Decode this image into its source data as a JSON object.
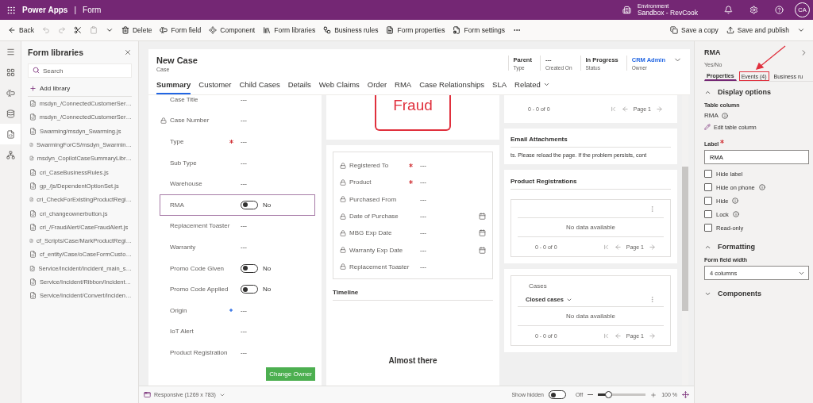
{
  "app_bar": {
    "app": "Power Apps",
    "separator": "|",
    "page": "Form",
    "environment_label": "Environment",
    "environment": "Sandbox - RevCook",
    "avatar": "CA"
  },
  "toolbar": {
    "items": [
      {
        "kind": "back",
        "label": "Back",
        "disabled": false
      },
      {
        "kind": "undo",
        "disabled": true
      },
      {
        "kind": "redo",
        "disabled": true
      },
      {
        "kind": "cut",
        "disabled": false
      },
      {
        "kind": "paste",
        "disabled": true
      },
      {
        "kind": "chevron"
      },
      {
        "kind": "delete",
        "label": "Delete",
        "disabled": false
      },
      {
        "kind": "field",
        "label": "Form field",
        "disabled": false
      },
      {
        "kind": "component",
        "label": "Component",
        "disabled": false
      },
      {
        "kind": "libraries",
        "label": "Form libraries",
        "disabled": false
      },
      {
        "kind": "rules",
        "label": "Business rules",
        "disabled": false
      },
      {
        "kind": "properties",
        "label": "Form properties",
        "disabled": false
      },
      {
        "kind": "settings",
        "label": "Form settings",
        "disabled": false
      },
      {
        "kind": "more",
        "disabled": false
      }
    ],
    "right": [
      {
        "kind": "copy",
        "label": "Save a copy"
      },
      {
        "kind": "publish",
        "label": "Save and publish"
      },
      {
        "kind": "chevron"
      }
    ]
  },
  "rail": [
    {
      "kind": "menu",
      "selected": false
    },
    {
      "kind": "components",
      "selected": false
    },
    {
      "kind": "fields",
      "selected": false
    },
    {
      "kind": "tables",
      "selected": false
    },
    {
      "kind": "libraries",
      "selected": true
    },
    {
      "kind": "tree",
      "selected": false
    }
  ],
  "libraries_panel": {
    "title": "Form libraries",
    "search": {
      "placeholder": "Search"
    },
    "add": "Add library",
    "items": [
      "msdyn_/ConnectedCustomerSer…",
      "msdyn_/ConnectedCustomerSer…",
      "Swarming/msdyn_Swarming.js",
      "SwarmingForCS/msdyn_Swarmin…",
      "msdyn_CopilotCaseSummaryLibr…",
      "cri_CaseBusinessRules.js",
      "gp_/js/DependentOptionSet.js",
      "cri_CheckForExistingProductRegi…",
      "cri_changeownerbutton.js",
      "cri_/FraudAlert/CaseFraudAlert.js",
      "cf_Scripts/Case/MarkProductRegi…",
      "cf_entity/Case/oCaseFormCusto…",
      "Service/Incident/Incident_main_s…",
      "Service/Incident/Ribbon/Incident…",
      "Service/Incident/Convert/Inciden…"
    ]
  },
  "form": {
    "title": "New Case",
    "entity": "Case",
    "header_fields": [
      {
        "value": "Parent",
        "label": "Type",
        "link": false
      },
      {
        "value": "---",
        "label": "Created On",
        "link": false
      },
      {
        "value": "In Progress",
        "label": "Status",
        "link": false
      },
      {
        "value": "CRM Admin",
        "label": "Owner",
        "link": true
      }
    ],
    "tabs": [
      {
        "label": "Summary",
        "selected": true
      },
      {
        "label": "Customer",
        "selected": false
      },
      {
        "label": "Child Cases",
        "selected": false
      },
      {
        "label": "Details",
        "selected": false
      },
      {
        "label": "Web Claims",
        "selected": false
      },
      {
        "label": "Order",
        "selected": false
      },
      {
        "label": "RMA",
        "selected": false
      },
      {
        "label": "Case Relationships",
        "selected": false
      },
      {
        "label": "SLA",
        "selected": false
      },
      {
        "label": "Related",
        "selected": false
      }
    ],
    "fields": [
      {
        "kind": "text",
        "label": "Case Title",
        "value": "---",
        "locked": false,
        "required": false,
        "recommended": false,
        "selected": false
      },
      {
        "kind": "text",
        "label": "Case Number",
        "value": "---",
        "locked": true,
        "required": false,
        "recommended": false,
        "selected": false
      },
      {
        "kind": "text",
        "label": "Type",
        "value": "---",
        "locked": false,
        "required": true,
        "recommended": false,
        "selected": false
      },
      {
        "kind": "text",
        "label": "Sub Type",
        "value": "---",
        "locked": false,
        "required": false,
        "recommended": false,
        "selected": false
      },
      {
        "kind": "text",
        "label": "Warehouse",
        "value": "---",
        "locked": false,
        "required": false,
        "recommended": false,
        "selected": false
      },
      {
        "kind": "toggle",
        "label": "RMA",
        "value": "No",
        "on": false,
        "locked": false,
        "required": false,
        "recommended": false,
        "selected": true
      },
      {
        "kind": "text",
        "label": "Replacement Toaster",
        "value": "---",
        "locked": false,
        "required": false,
        "recommended": false,
        "selected": false
      },
      {
        "kind": "text",
        "label": "Warranty",
        "value": "---",
        "locked": false,
        "required": false,
        "recommended": false,
        "selected": false
      },
      {
        "kind": "toggle",
        "label": "Promo Code Given",
        "value": "No",
        "on": false,
        "locked": false,
        "required": false,
        "recommended": false,
        "selected": false
      },
      {
        "kind": "toggle",
        "label": "Promo Code Applied",
        "value": "No",
        "on": false,
        "locked": false,
        "required": false,
        "recommended": false,
        "selected": false
      },
      {
        "kind": "text",
        "label": "Origin",
        "value": "---",
        "locked": false,
        "required": false,
        "recommended": true,
        "selected": false
      },
      {
        "kind": "text",
        "label": "IoT Alert",
        "value": "---",
        "locked": false,
        "required": false,
        "recommended": false,
        "selected": false
      },
      {
        "kind": "text",
        "label": "Product Registration",
        "value": "---",
        "locked": false,
        "required": false,
        "recommended": false,
        "selected": false
      }
    ],
    "button": "Change Owner",
    "alert_badge": "Fraud",
    "product_fields": [
      {
        "kind": "text",
        "label": "Registered To",
        "value": "---",
        "locked": true,
        "required": true
      },
      {
        "kind": "text",
        "label": "Product",
        "value": "---",
        "locked": true,
        "required": true
      },
      {
        "kind": "text",
        "label": "Purchased From",
        "value": "---",
        "locked": true,
        "required": false
      },
      {
        "kind": "date",
        "label": "Date of Purchase",
        "value": "---",
        "locked": true,
        "required": false
      },
      {
        "kind": "date",
        "label": "MBG Exp Date",
        "value": "---",
        "locked": true,
        "required": false
      },
      {
        "kind": "date",
        "label": "Warranty Exp Date",
        "value": "---",
        "locked": true,
        "required": false
      },
      {
        "kind": "text",
        "label": "Replacement Toaster",
        "value": "---",
        "locked": true,
        "required": false
      }
    ],
    "timeline": {
      "title": "Timeline",
      "message": "Almost there"
    },
    "top_grid": {
      "count": "0 - 0 of 0",
      "page": "Page 1"
    },
    "email_attachments": {
      "title": "Email Attachments",
      "message": "ts.  Please reload the page. If the problem persists, cont"
    },
    "product_registrations": {
      "title": "Product Registrations",
      "empty": "No data available",
      "count": "0 - 0 of 0",
      "page": "Page 1"
    },
    "cases": {
      "title": "Cases",
      "view": "Closed cases",
      "empty": "No data available",
      "count": "0 - 0 of 0",
      "page": "Page 1"
    }
  },
  "status_bar": {
    "layout": "Responsive (1269 x 783)",
    "show_hidden": "Show hidden",
    "show_hidden_on": false,
    "show_hidden_value": "Off",
    "zoom": {
      "level": 0.22,
      "reading": "100 %"
    }
  },
  "properties_panel": {
    "title": "RMA",
    "subtitle": "Yes/No",
    "tabs": [
      {
        "label": "Properties",
        "selected": true,
        "highlighted": false
      },
      {
        "label": "Events (4)",
        "selected": false,
        "highlighted": true
      },
      {
        "label": "Business ru",
        "selected": false,
        "highlighted": false
      }
    ],
    "display_options": {
      "title": "Display options",
      "expanded": true
    },
    "table_column_label": "Table column",
    "table_column": "RMA",
    "edit_column": "Edit table column",
    "label_field": {
      "label": "Label",
      "required": true,
      "value": "RMA"
    },
    "options": [
      {
        "label": "Hide label",
        "checked": false,
        "info": false
      },
      {
        "label": "Hide on phone",
        "checked": false,
        "info": true
      },
      {
        "label": "Hide",
        "checked": false,
        "info": true
      },
      {
        "label": "Lock",
        "checked": false,
        "info": true
      },
      {
        "label": "Read-only",
        "checked": false,
        "info": false
      }
    ],
    "formatting": {
      "title": "Formatting",
      "expanded": true
    },
    "width_label": "Form field width",
    "width_value": "4 columns",
    "components": {
      "title": "Components",
      "expanded": false
    }
  }
}
